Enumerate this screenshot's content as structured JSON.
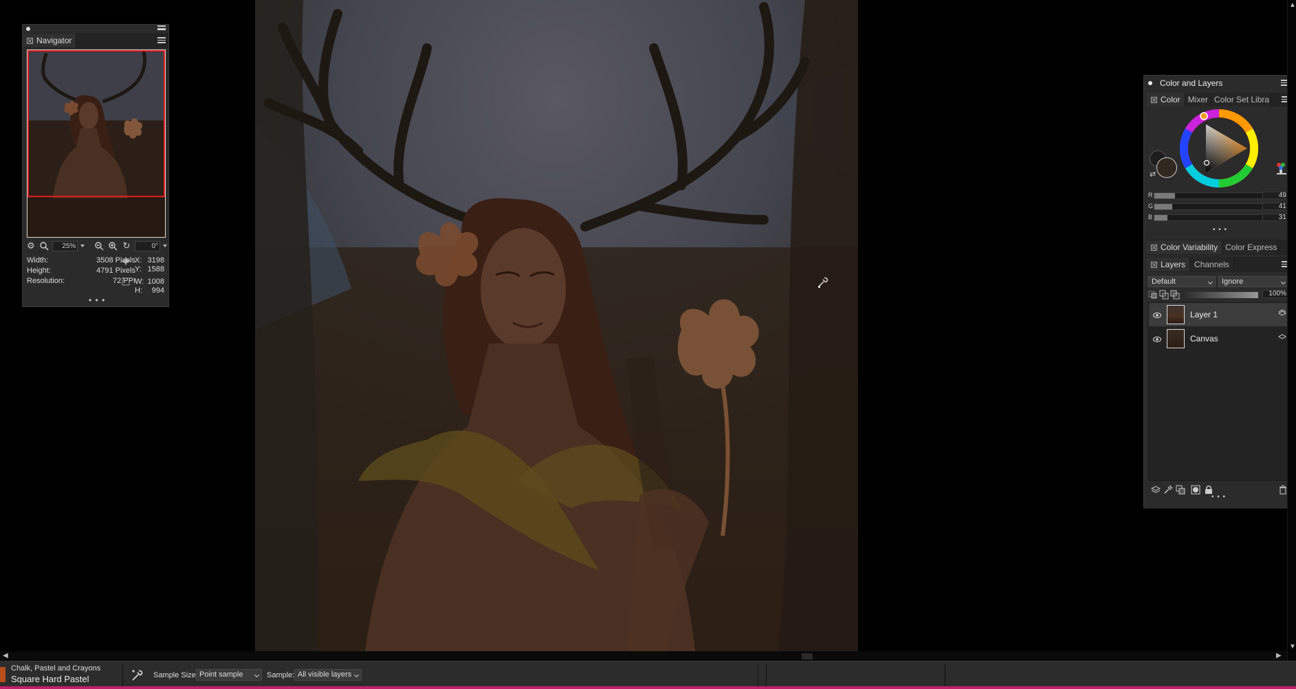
{
  "navigator": {
    "tab_label": "Navigator",
    "zoom": "25%",
    "rotation": "0°",
    "info": {
      "width_label": "Width:",
      "width_value": "3508 Pixels",
      "height_label": "Height:",
      "height_value": "4791 Pixels",
      "resolution_label": "Resolution:",
      "resolution_value": "72 PPI",
      "x_label": "X:",
      "x_value": "3198",
      "y_label": "Y:",
      "y_value": "1588",
      "w_label": "W:",
      "w_value": "1008",
      "h_label": "H:",
      "h_value": "994"
    },
    "more": "• • •"
  },
  "color_layers": {
    "title": "Color and Layers",
    "color_tabs": [
      {
        "label": "Color",
        "active": true
      },
      {
        "label": "Mixer",
        "active": false
      },
      {
        "label": "Color Set Librarie",
        "active": false
      }
    ],
    "rgb": [
      {
        "label": "R",
        "value": "49",
        "fraction": 0.19
      },
      {
        "label": "G",
        "value": "41",
        "fraction": 0.16
      },
      {
        "label": "B",
        "value": "31",
        "fraction": 0.12
      }
    ],
    "more": "• • •",
    "variability_tabs": [
      {
        "label": "Color Variability",
        "active": true
      },
      {
        "label": "Color Expressi",
        "active": false
      }
    ],
    "layer_tabs": [
      {
        "label": "Layers",
        "active": true
      },
      {
        "label": "Channels",
        "active": false
      }
    ],
    "composite_method": "Default",
    "composite_depth": "Ignore",
    "opacity": "100%",
    "layers": [
      {
        "name": "Layer 1",
        "selected": true
      },
      {
        "name": "Canvas",
        "selected": false
      }
    ],
    "layers_more": "• • •",
    "colors": {
      "main_color": "#31291f",
      "secondary_color": "#1d1d1d",
      "hue_marker": "#f29a1e"
    }
  },
  "bottom_bar": {
    "brush_category": "Chalk, Pastel and Crayons",
    "brush_name": "Square Hard Pastel",
    "sample_size_label": "Sample Size:",
    "sample_size_value": "Point sample",
    "sample_label": "Sample:",
    "sample_value": "All visible layers",
    "accent_color": "#c01f6a"
  }
}
